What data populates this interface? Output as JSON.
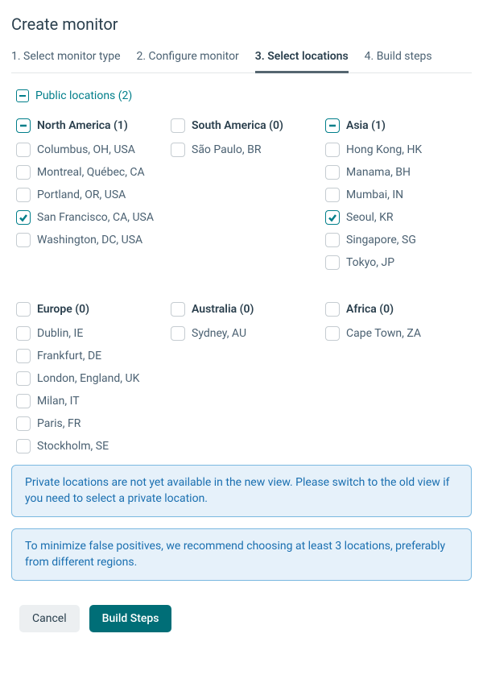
{
  "page_title": "Create monitor",
  "tabs": [
    {
      "label": "1. Select monitor type",
      "active": false
    },
    {
      "label": "2. Configure monitor",
      "active": false
    },
    {
      "label": "3. Select locations",
      "active": true
    },
    {
      "label": "4. Build steps",
      "active": false
    }
  ],
  "public_locations_label": "Public locations (2)",
  "regions": [
    {
      "name": "North America (1)",
      "state": "indeterminate",
      "locations": [
        {
          "label": "Columbus, OH, USA",
          "checked": false
        },
        {
          "label": "Montreal, Québec, CA",
          "checked": false
        },
        {
          "label": "Portland, OR, USA",
          "checked": false
        },
        {
          "label": "San Francisco, CA, USA",
          "checked": true
        },
        {
          "label": "Washington, DC, USA",
          "checked": false
        }
      ]
    },
    {
      "name": "South America (0)",
      "state": "unchecked",
      "locations": [
        {
          "label": "São Paulo, BR",
          "checked": false
        }
      ]
    },
    {
      "name": "Asia (1)",
      "state": "indeterminate",
      "locations": [
        {
          "label": "Hong Kong, HK",
          "checked": false
        },
        {
          "label": "Manama, BH",
          "checked": false
        },
        {
          "label": "Mumbai, IN",
          "checked": false
        },
        {
          "label": "Seoul, KR",
          "checked": true
        },
        {
          "label": "Singapore, SG",
          "checked": false
        },
        {
          "label": "Tokyo, JP",
          "checked": false
        }
      ]
    },
    {
      "name": "Europe (0)",
      "state": "unchecked",
      "locations": [
        {
          "label": "Dublin, IE",
          "checked": false
        },
        {
          "label": "Frankfurt, DE",
          "checked": false
        },
        {
          "label": "London, England, UK",
          "checked": false
        },
        {
          "label": "Milan, IT",
          "checked": false
        },
        {
          "label": "Paris, FR",
          "checked": false
        },
        {
          "label": "Stockholm, SE",
          "checked": false
        }
      ]
    },
    {
      "name": "Australia (0)",
      "state": "unchecked",
      "locations": [
        {
          "label": "Sydney, AU",
          "checked": false
        }
      ]
    },
    {
      "name": "Africa (0)",
      "state": "unchecked",
      "locations": [
        {
          "label": "Cape Town, ZA",
          "checked": false
        }
      ]
    }
  ],
  "info_boxes": [
    "Private locations are not yet available in the new view. Please switch to the old view if you need to select a private location.",
    "To minimize false positives, we recommend choosing at least 3 locations, preferably from different regions."
  ],
  "buttons": {
    "cancel": "Cancel",
    "primary": "Build Steps"
  }
}
